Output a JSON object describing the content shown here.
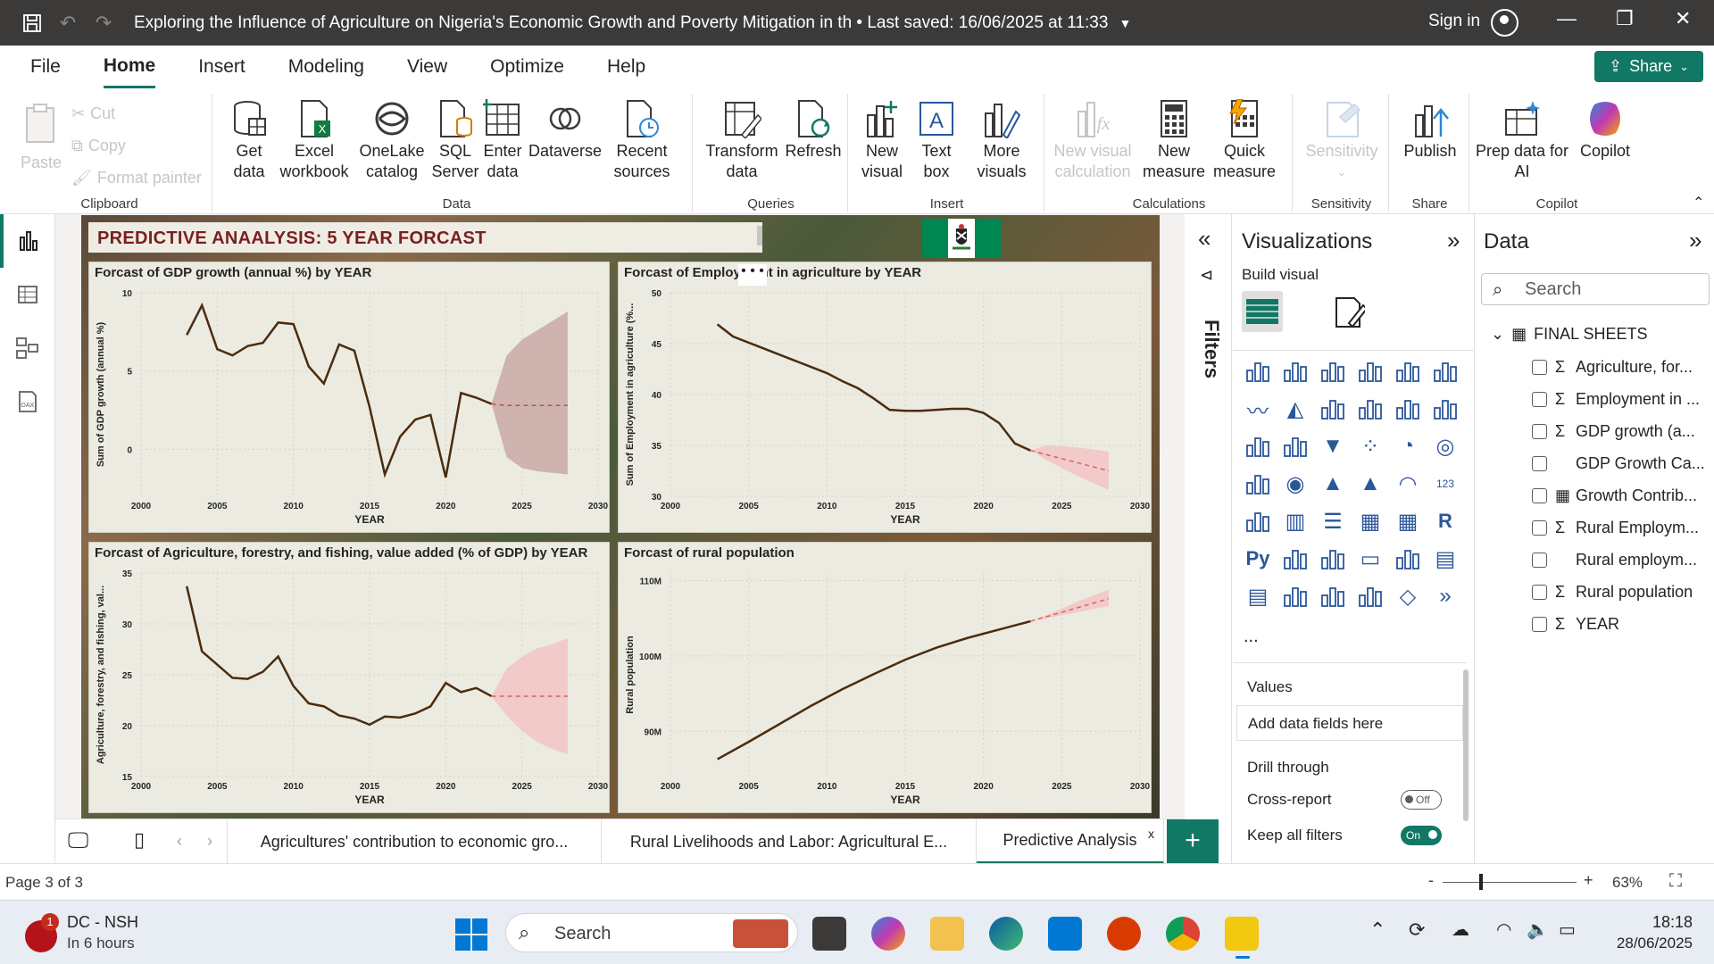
{
  "window": {
    "title": "Exploring the Influence of Agriculture on Nigeria's Economic Growth and Poverty Mitigation in th • Last saved: 16/06/2025 at 11:33",
    "sign_in": "Sign in"
  },
  "menu": [
    "File",
    "Home",
    "Insert",
    "Modeling",
    "View",
    "Optimize",
    "Help"
  ],
  "share_label": "Share",
  "ribbon": {
    "clipboard": {
      "label": "Clipboard",
      "paste": "Paste",
      "cut": "Cut",
      "copy": "Copy",
      "format_painter": "Format painter"
    },
    "data": {
      "label": "Data",
      "get_data": "Get data",
      "excel": "Excel workbook",
      "onelake": "OneLake catalog",
      "sql": "SQL Server",
      "enter": "Enter data",
      "dataverse": "Dataverse",
      "recent": "Recent sources"
    },
    "queries": {
      "label": "Queries",
      "transform": "Transform data",
      "refresh": "Refresh"
    },
    "insert": {
      "label": "Insert",
      "new_visual": "New visual",
      "text_box": "Text box",
      "more_visuals": "More visuals"
    },
    "calculations": {
      "label": "Calculations",
      "new_visual_calc": "New visual calculation",
      "new_measure": "New measure",
      "quick_measure": "Quick measure"
    },
    "sensitivity": {
      "label": "Sensitivity",
      "sensitivity": "Sensitivity"
    },
    "share": {
      "label": "Share",
      "publish": "Publish"
    },
    "copilot": {
      "label": "Copilot",
      "prep": "Prep data for AI",
      "copilot": "Copilot"
    }
  },
  "report": {
    "title": "PREDICTIVE ANAALYSIS: 5 YEAR FORCAST",
    "flag_colors": [
      "#008751",
      "#ffffff",
      "#008751"
    ]
  },
  "chart_data": [
    {
      "type": "line",
      "title": "Forcast of GDP growth (annual %) by YEAR",
      "xlabel": "YEAR",
      "ylabel": "Sum of GDP growth (annual %)",
      "xlim": [
        2000,
        2030
      ],
      "ylim": [
        -3,
        10
      ],
      "y_ticks": [
        0,
        5,
        10
      ],
      "x_ticks": [
        2000,
        2005,
        2010,
        2015,
        2020,
        2025,
        2030
      ],
      "series": [
        {
          "x": [
            2003,
            2004,
            2005,
            2006,
            2007,
            2008,
            2009,
            2010,
            2011,
            2012,
            2013,
            2014,
            2015,
            2016,
            2017,
            2018,
            2019,
            2020,
            2021,
            2022,
            2023
          ],
          "values": [
            7.3,
            9.2,
            6.4,
            6.0,
            6.6,
            6.8,
            8.1,
            8.0,
            5.3,
            4.2,
            6.7,
            6.3,
            2.7,
            -1.6,
            0.8,
            1.9,
            2.2,
            -1.8,
            3.6,
            3.3,
            2.9
          ]
        }
      ],
      "forecast": {
        "x": [
          2023,
          2024,
          2025,
          2026,
          2027,
          2028
        ],
        "values": [
          2.9,
          2.8,
          2.8,
          2.8,
          2.8,
          2.8
        ],
        "lower": [
          2.9,
          -0.5,
          -1.2,
          -1.4,
          -1.5,
          -1.6
        ],
        "upper": [
          2.9,
          6.0,
          7.0,
          7.6,
          8.2,
          8.8
        ]
      },
      "colors": {
        "line": "#4a2c10",
        "band": "#c9a9a6",
        "forecast": "#c0504d"
      }
    },
    {
      "type": "line",
      "title": "Forcast of Employment in agriculture by YEAR",
      "xlabel": "YEAR",
      "ylabel": "Sum of Employment in agriculture (%...",
      "xlim": [
        2000,
        2030
      ],
      "ylim": [
        30,
        50
      ],
      "y_ticks": [
        30,
        35,
        40,
        45,
        50
      ],
      "x_ticks": [
        2000,
        2005,
        2010,
        2015,
        2020,
        2025,
        2030
      ],
      "series": [
        {
          "x": [
            2003,
            2004,
            2005,
            2006,
            2007,
            2008,
            2009,
            2010,
            2011,
            2012,
            2013,
            2014,
            2015,
            2016,
            2017,
            2018,
            2019,
            2020,
            2021,
            2022,
            2023
          ],
          "values": [
            46.9,
            45.7,
            45.1,
            44.5,
            43.9,
            43.3,
            42.7,
            42.1,
            41.3,
            40.6,
            39.6,
            38.5,
            38.4,
            38.4,
            38.5,
            38.6,
            38.6,
            38.2,
            37.2,
            35.2,
            34.5
          ]
        }
      ],
      "forecast": {
        "x": [
          2023,
          2024,
          2025,
          2026,
          2027,
          2028
        ],
        "values": [
          34.5,
          34.1,
          33.7,
          33.3,
          32.9,
          32.5
        ],
        "lower": [
          34.5,
          33.6,
          32.8,
          32.0,
          31.3,
          30.6
        ],
        "upper": [
          34.5,
          35.0,
          34.9,
          34.8,
          34.6,
          34.4
        ]
      },
      "colors": {
        "line": "#4a2c10",
        "band": "#f2c4c4",
        "forecast": "#e06060"
      }
    },
    {
      "type": "line",
      "title": "Forcast of Agriculture, forestry, and fishing, value added (% of GDP) by YEAR",
      "xlabel": "YEAR",
      "ylabel": "Agriculture, forestry, and fishing, val...",
      "xlim": [
        2000,
        2030
      ],
      "ylim": [
        15,
        35
      ],
      "y_ticks": [
        15,
        20,
        25,
        30,
        35
      ],
      "x_ticks": [
        2000,
        2005,
        2010,
        2015,
        2020,
        2025,
        2030
      ],
      "series": [
        {
          "x": [
            2003,
            2004,
            2005,
            2006,
            2007,
            2008,
            2009,
            2010,
            2011,
            2012,
            2013,
            2014,
            2015,
            2016,
            2017,
            2018,
            2019,
            2020,
            2021,
            2022,
            2023
          ],
          "values": [
            33.7,
            27.3,
            26.0,
            24.7,
            24.6,
            25.3,
            26.8,
            23.9,
            22.2,
            21.9,
            21.0,
            20.7,
            20.1,
            20.9,
            20.8,
            21.2,
            21.9,
            24.2,
            23.3,
            23.7,
            22.9
          ]
        }
      ],
      "forecast": {
        "x": [
          2023,
          2024,
          2025,
          2026,
          2027,
          2028
        ],
        "values": [
          22.9,
          22.9,
          22.9,
          22.9,
          22.9,
          22.9
        ],
        "lower": [
          22.9,
          21.0,
          19.5,
          18.4,
          17.7,
          17.2
        ],
        "upper": [
          22.9,
          25.6,
          26.8,
          27.6,
          28.0,
          28.6
        ]
      },
      "colors": {
        "line": "#4a2c10",
        "band": "#f2c4c4",
        "forecast": "#e06060"
      }
    },
    {
      "type": "line",
      "title": "Forcast of rural population",
      "xlabel": "YEAR",
      "ylabel": "Rural population",
      "xlim": [
        2000,
        2030
      ],
      "ylim": [
        84,
        111
      ],
      "y_ticks": [
        "90M",
        "100M",
        "110M"
      ],
      "x_ticks": [
        2000,
        2005,
        2010,
        2015,
        2020,
        2025,
        2030
      ],
      "series": [
        {
          "x": [
            2003,
            2005,
            2007,
            2009,
            2011,
            2013,
            2015,
            2017,
            2019,
            2021,
            2023
          ],
          "values": [
            86.3,
            88.6,
            91.0,
            93.4,
            95.6,
            97.6,
            99.5,
            101.1,
            102.4,
            103.5,
            104.6
          ]
        }
      ],
      "forecast": {
        "x": [
          2023,
          2024,
          2025,
          2026,
          2027,
          2028
        ],
        "values": [
          104.6,
          105.2,
          105.8,
          106.4,
          107.0,
          107.6
        ],
        "lower": [
          104.6,
          105.0,
          105.4,
          105.8,
          106.2,
          106.6
        ],
        "upper": [
          104.6,
          105.4,
          106.3,
          107.2,
          108.0,
          108.8
        ]
      },
      "colors": {
        "line": "#4a2c10",
        "band": "#f2c4c4",
        "forecast": "#e06060"
      }
    }
  ],
  "visualizations": {
    "title": "Visualizations",
    "build_visual": "Build visual",
    "values": "Values",
    "add_fields": "Add data fields here",
    "drill_through": "Drill through",
    "cross_report": "Cross-report",
    "cross_report_state": "Off",
    "keep_filters": "Keep all filters",
    "keep_filters_state": "On",
    "more": "...",
    "python": "Py",
    "r": "R"
  },
  "filters_label": "Filters",
  "data_pane": {
    "title": "Data",
    "search_placeholder": "Search",
    "table": "FINAL SHEETS",
    "fields": [
      {
        "name": "Agriculture, for...",
        "icon": "sigma"
      },
      {
        "name": "Employment in ...",
        "icon": "sigma"
      },
      {
        "name": "GDP growth (a...",
        "icon": "sigma"
      },
      {
        "name": "GDP Growth Ca...",
        "icon": "none"
      },
      {
        "name": "Growth Contrib...",
        "icon": "calculator"
      },
      {
        "name": "Rural Employm...",
        "icon": "sigma"
      },
      {
        "name": "Rural employm...",
        "icon": "none"
      },
      {
        "name": "Rural population",
        "icon": "sigma"
      },
      {
        "name": "YEAR",
        "icon": "sigma"
      }
    ]
  },
  "tabs": [
    "Agricultures' contribution to economic gro...",
    "Rural Livelihoods and Labor: Agricultural E...",
    "Predictive Analysis"
  ],
  "status": {
    "page": "Page 3 of 3",
    "zoom": "63%"
  },
  "taskbar": {
    "notification": "DC - NSH",
    "notification_sub": "In 6 hours",
    "badge": "1",
    "search": "Search",
    "time": "18:18",
    "date": "28/06/2025"
  }
}
